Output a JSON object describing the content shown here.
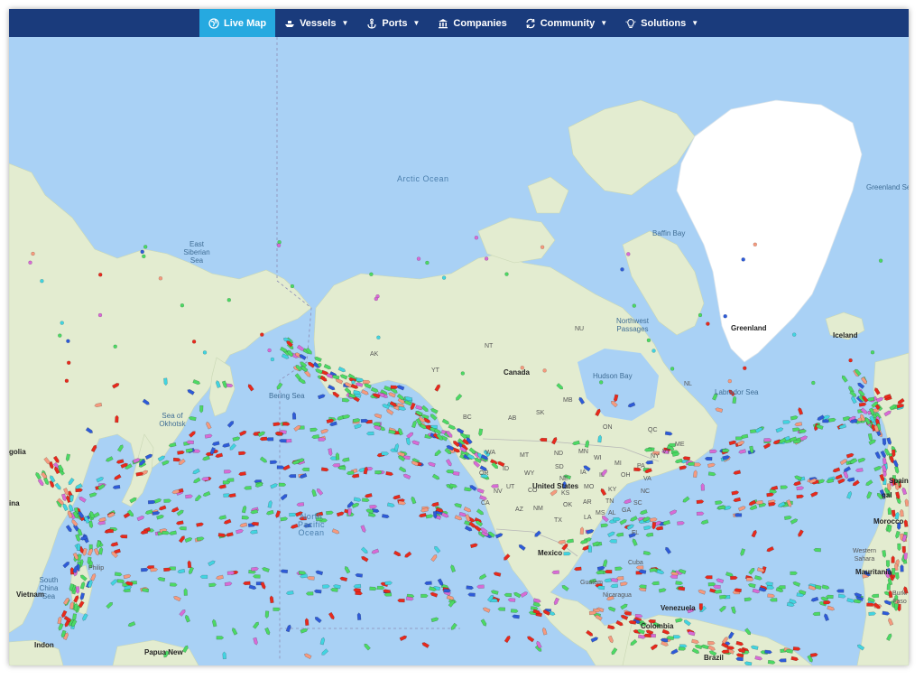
{
  "nav": {
    "items": [
      {
        "label": "Live Map",
        "icon": "globe-icon",
        "dropdown": false,
        "active": true
      },
      {
        "label": "Vessels",
        "icon": "ship-icon",
        "dropdown": true,
        "active": false
      },
      {
        "label": "Ports",
        "icon": "anchor-icon",
        "dropdown": true,
        "active": false
      },
      {
        "label": "Companies",
        "icon": "building-icon",
        "dropdown": false,
        "active": false
      },
      {
        "label": "Community",
        "icon": "sync-icon",
        "dropdown": true,
        "active": false
      },
      {
        "label": "Solutions",
        "icon": "lightbulb-icon",
        "dropdown": true,
        "active": false
      }
    ]
  },
  "colors": {
    "navbar": "#1a3b7c",
    "active_tab": "#26a9e0",
    "ocean": "#a9d1f5",
    "land": "#e9efd8",
    "ice": "#ffffff",
    "vessel_cargo": "#4cd964",
    "vessel_tanker": "#e8291c",
    "vessel_passenger": "#2e5bd8",
    "vessel_fishing": "#f59a7e",
    "vessel_pleasure": "#d86bd6",
    "vessel_tug": "#42d4e0"
  },
  "map": {
    "oceans": {
      "arctic": "Arctic Ocean",
      "north_pacific": "North Pacific Ocean",
      "east_siberian": "East Siberian Sea",
      "bering": "Bering Sea",
      "okhotsk": "Sea of Okhotsk",
      "baffin": "Baffin Bay",
      "labrador": "Labrador Sea",
      "greenland_sea": "Greenland Sea",
      "south_china": "South China Sea"
    },
    "places": {
      "greenland": "Greenland",
      "iceland": "Iceland",
      "canada": "Canada",
      "united_states": "United States",
      "mexico": "Mexico",
      "venezuela": "Venezuela",
      "colombia": "Colombia",
      "brazil": "Brazil",
      "spain": "Spain",
      "morocco": "Morocco",
      "western_sahara": "Western Sahara",
      "mauritania": "Mauritania",
      "vietnam": "Vietnam",
      "mongolia": "golia",
      "china": "ina",
      "guatemala": "Guatem",
      "nicaragua": "Nicaragua",
      "cuba": "Cuba",
      "northwest_passages": "Northwest Passages",
      "hudson_bay": "Hudson Bay",
      "papua": "Papua New",
      "indonesia": "Indon",
      "portugal": "gal",
      "burkina": "Burki Faso",
      "philippines": "Philip"
    },
    "states": [
      "NU",
      "NT",
      "YT",
      "BC",
      "AB",
      "SK",
      "MB",
      "ON",
      "QC",
      "NL",
      "WA",
      "OR",
      "CA",
      "NV",
      "ID",
      "MT",
      "WY",
      "ND",
      "SD",
      "NE",
      "UT",
      "CO",
      "AZ",
      "NM",
      "KS",
      "OK",
      "TX",
      "MN",
      "WI",
      "IA",
      "MO",
      "AR",
      "LA",
      "IL",
      "MI",
      "OH",
      "KY",
      "TN",
      "MS",
      "AL",
      "GA",
      "FL",
      "SC",
      "NC",
      "VA",
      "PA",
      "NY",
      "ME",
      "VT",
      "AK"
    ]
  }
}
